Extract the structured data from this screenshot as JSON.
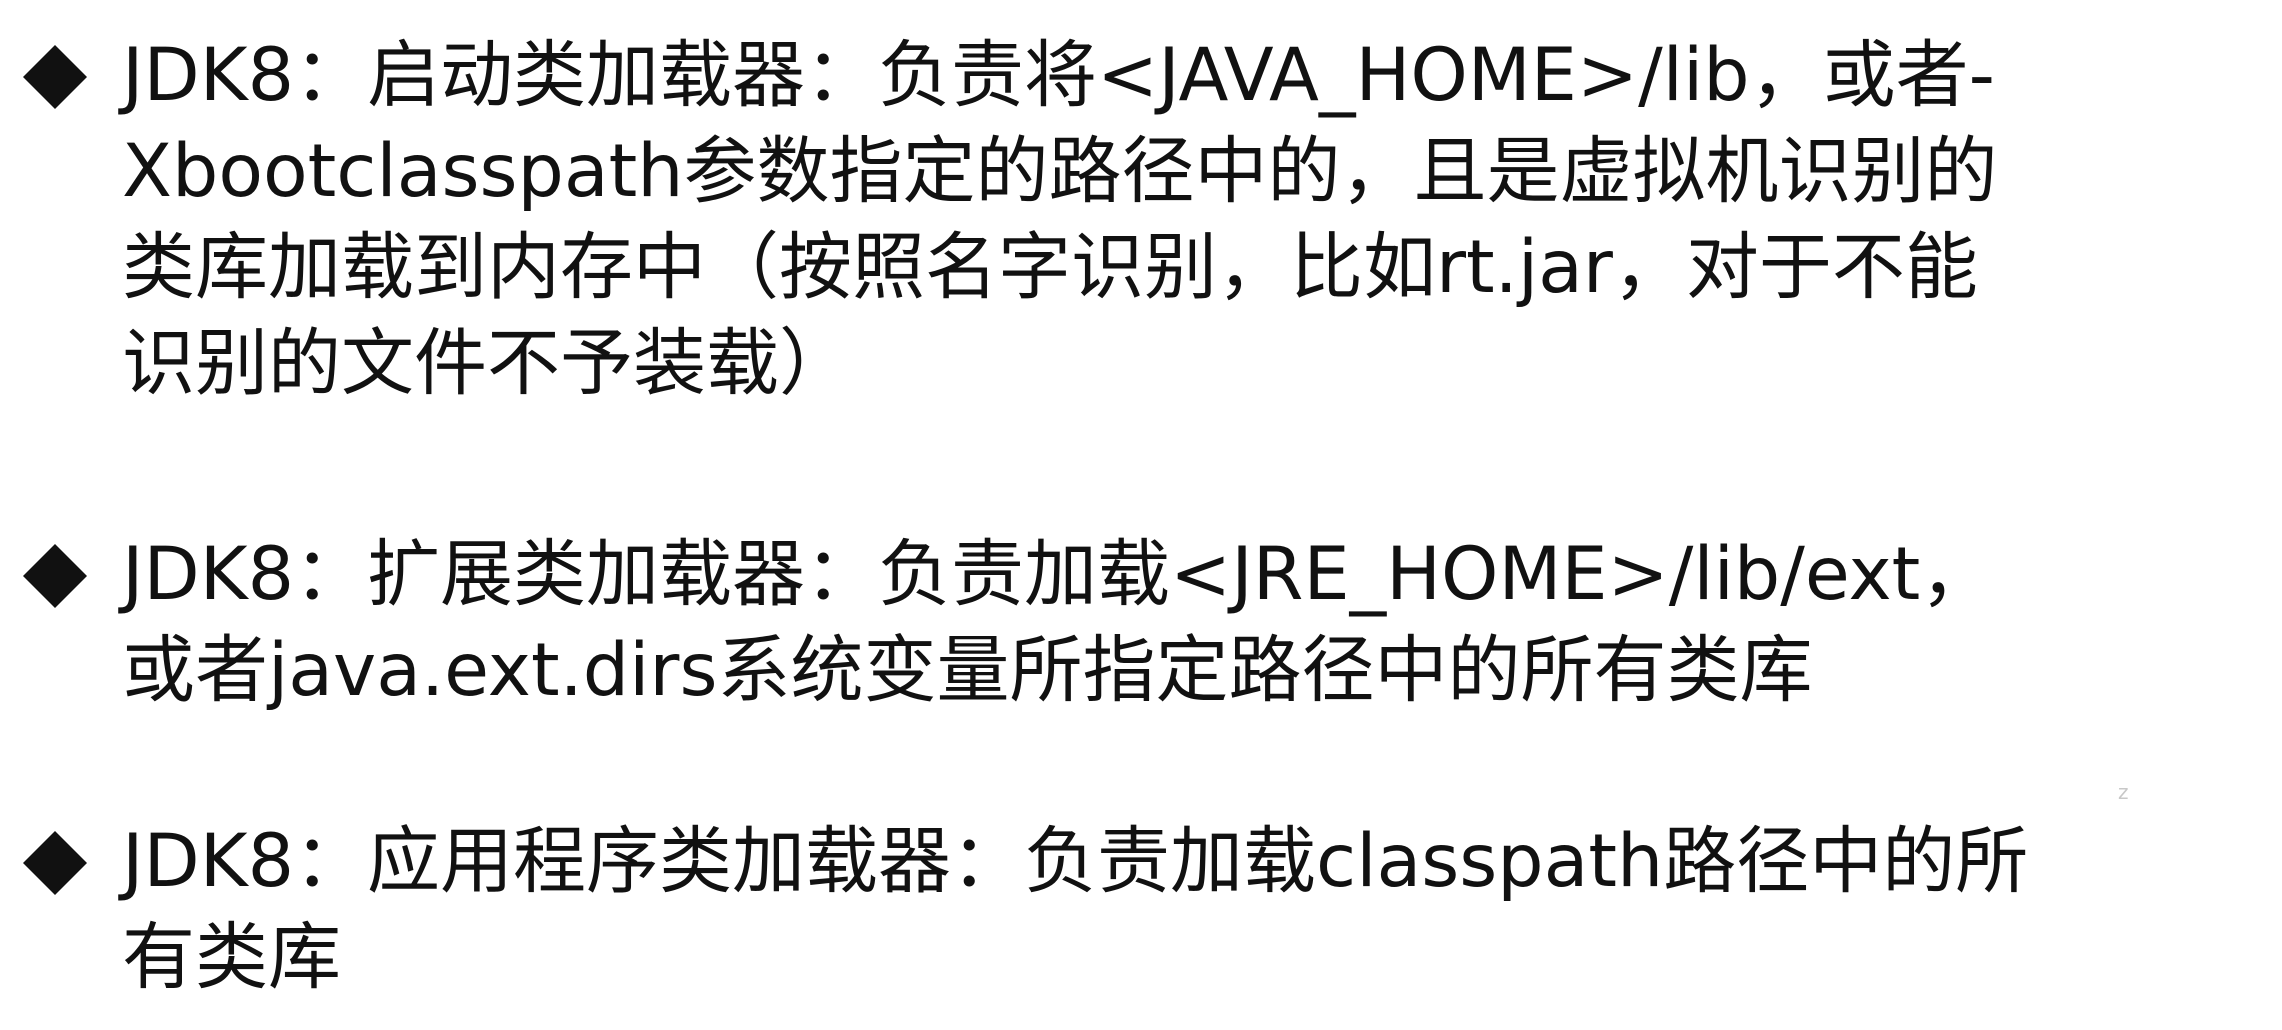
{
  "bullets": [
    {
      "marker_icon": "diamond-bullet-icon",
      "lines": [
        "JDK8：启动类加载器：负责将<JAVA_HOME>/lib，或者-",
        "Xbootclasspath参数指定的路径中的，且是虚拟机识别的",
        "类库加载到内存中（按照名字识别，比如rt.jar，对于不能",
        "识别的文件不予装载）"
      ]
    },
    {
      "marker_icon": "diamond-bullet-icon",
      "lines": [
        "JDK8：扩展类加载器：负责加载<JRE_HOME>/lib/ext，",
        "或者java.ext.dirs系统变量所指定路径中的所有类库"
      ]
    },
    {
      "marker_icon": "diamond-bullet-icon",
      "lines": [
        "JDK8：应用程序类加载器：负责加载classpath路径中的所",
        "有类库"
      ]
    }
  ],
  "watermark": "z",
  "colors": {
    "text": "#111111",
    "bullet": "#111111",
    "background": "#ffffff",
    "watermark": "#c8c8c8"
  }
}
